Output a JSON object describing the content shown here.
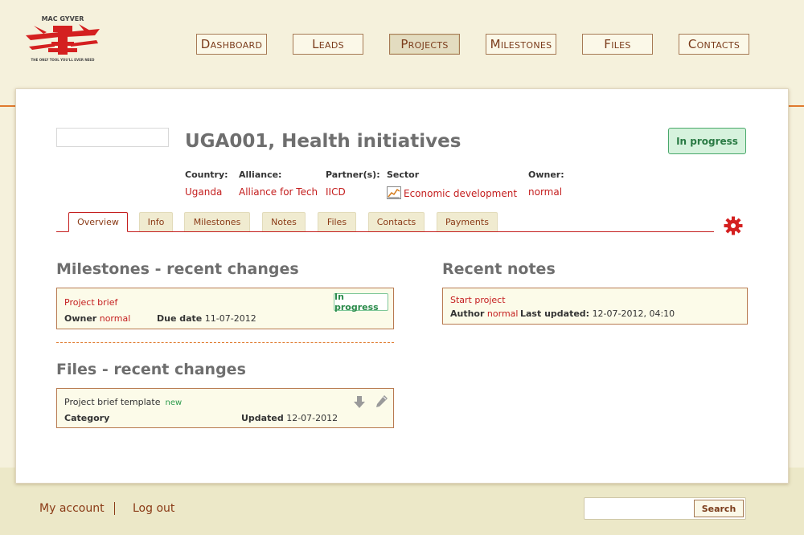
{
  "logo": {
    "text_top": "MAC GYVER",
    "text_bottom": "THE ONLY TOOL YOU'LL EVER NEED"
  },
  "nav": {
    "items": [
      {
        "label": "Dashboard"
      },
      {
        "label": "Leads"
      },
      {
        "label": "Projects"
      },
      {
        "label": "Milestones"
      },
      {
        "label": "Files"
      },
      {
        "label": "Contacts"
      }
    ],
    "active": "Projects"
  },
  "project": {
    "title": "UGA001, Health initiatives",
    "status": "In progress",
    "meta": [
      {
        "key": "Country:",
        "value": "Uganda"
      },
      {
        "key": "Alliance:",
        "value": "Alliance for Tech"
      },
      {
        "key": "Partner(s):",
        "value": "IICD"
      },
      {
        "key": "Sector",
        "value": "Economic development",
        "icon": "chart-icon"
      },
      {
        "key": "Owner:",
        "value": "normal"
      }
    ]
  },
  "tabs": [
    {
      "label": "Overview"
    },
    {
      "label": "Info"
    },
    {
      "label": "Milestones"
    },
    {
      "label": "Notes"
    },
    {
      "label": "Files"
    },
    {
      "label": "Contacts"
    },
    {
      "label": "Payments"
    }
  ],
  "active_tab": "Overview",
  "milestones": {
    "title": "Milestones - recent changes",
    "item": {
      "name": "Project brief",
      "status": "In progress",
      "owner_label": "Owner",
      "owner": "normal",
      "due_label": "Due date",
      "due": "11-07-2012"
    }
  },
  "files": {
    "title": "Files - recent changes",
    "item": {
      "name": "Project brief template",
      "tag": "new",
      "category_label": "Category",
      "updated_label": "Updated",
      "updated": "12-07-2012"
    }
  },
  "notes": {
    "title": "Recent notes",
    "item": {
      "name": "Start project",
      "author_label": "Author",
      "author": "normal",
      "updated_label": "Last updated:",
      "updated": "12-07-2012, 04:10"
    }
  },
  "footer": {
    "my_account": "My account",
    "log_out": "Log out",
    "search_placeholder": "",
    "search_button": "Search"
  },
  "colors": {
    "accent_red": "#c41e1e",
    "orange": "#e07a2e",
    "status_green": "#49a86a",
    "background": "#f5f1dc"
  }
}
